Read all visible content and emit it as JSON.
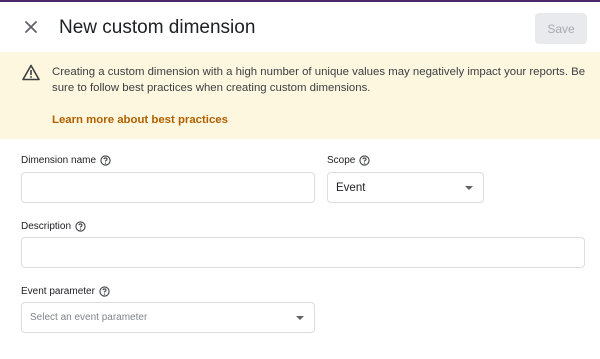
{
  "dialog": {
    "title": "New custom dimension",
    "close_icon": "close-icon",
    "save_label": "Save"
  },
  "banner": {
    "icon": "warning-icon",
    "message": "Creating a custom dimension with a high number of unique values may negatively impact your reports. Be sure to follow best practices when creating custom dimensions.",
    "link_label": "Learn more about best practices"
  },
  "form": {
    "dimension_name": {
      "label": "Dimension name",
      "value": "",
      "help_icon": "help-circle-icon"
    },
    "scope": {
      "label": "Scope",
      "selected": "Event",
      "help_icon": "help-circle-icon"
    },
    "description": {
      "label": "Description",
      "value": "",
      "help_icon": "help-circle-icon"
    },
    "event_parameter": {
      "label": "Event parameter",
      "placeholder": "Select an event parameter",
      "help_icon": "help-circle-icon"
    }
  },
  "colors": {
    "banner_bg": "#fef7e0",
    "link": "#b06000",
    "save_disabled_bg": "#e8eaed"
  }
}
